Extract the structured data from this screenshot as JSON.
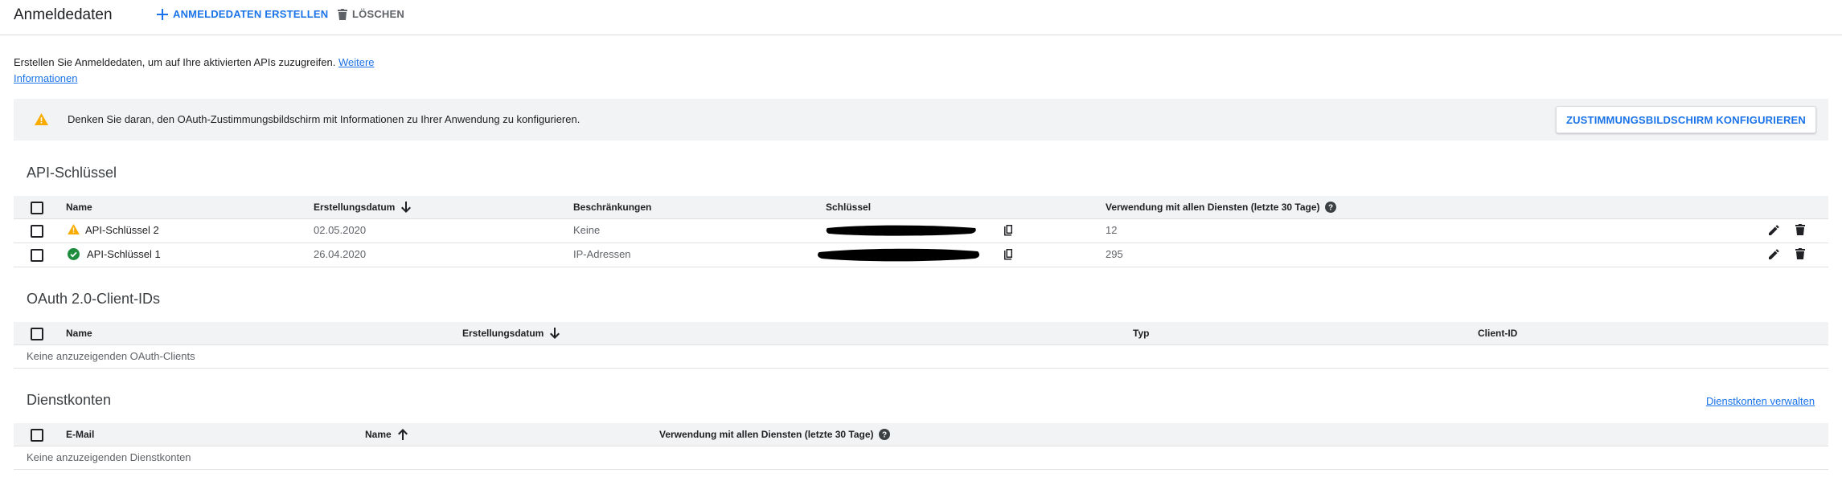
{
  "header": {
    "title": "Anmeldedaten",
    "create_label": "ANMELDEDATEN ERSTELLEN",
    "delete_label": "LÖSCHEN"
  },
  "intro": {
    "text": "Erstellen Sie Anmeldedaten, um auf Ihre aktivierten APIs zuzugreifen. ",
    "link": "Weitere Informationen"
  },
  "banner": {
    "message": "Denken Sie daran, den OAuth-Zustimmungsbildschirm mit Informationen zu Ihrer Anwendung zu konfigurieren.",
    "button": "ZUSTIMMUNGSBILDSCHIRM KONFIGURIEREN"
  },
  "api_keys": {
    "title": "API-Schlüssel",
    "columns": [
      "Name",
      "Erstellungsdatum",
      "Beschränkungen",
      "Schlüssel",
      "Verwendung mit allen Diensten (letzte 30 Tage)"
    ],
    "rows": [
      {
        "name": "API-Schlüssel 2",
        "status_icon": "warning-icon",
        "date": "02.05.2020",
        "restriction": "Keine",
        "usage": "12"
      },
      {
        "name": "API-Schlüssel 1",
        "status_icon": "check-circle-icon",
        "date": "26.04.2020",
        "restriction": "IP-Adressen",
        "usage": "295"
      }
    ]
  },
  "oauth": {
    "title": "OAuth 2.0-Client-IDs",
    "columns": [
      "Name",
      "Erstellungsdatum",
      "Typ",
      "Client-ID"
    ],
    "empty": "Keine anzuzeigenden OAuth-Clients"
  },
  "service_accounts": {
    "title": "Dienstkonten",
    "manage_link": "Dienstkonten verwalten",
    "columns": [
      "E-Mail",
      "Name",
      "Verwendung mit allen Diensten (letzte 30 Tage)"
    ],
    "empty": "Keine anzuzeigenden Dienstkonten"
  },
  "colors": {
    "accent": "#1a73e8",
    "warning": "#f9ab00",
    "success": "#1e8e3e",
    "header_bg": "#f1f3f4"
  }
}
